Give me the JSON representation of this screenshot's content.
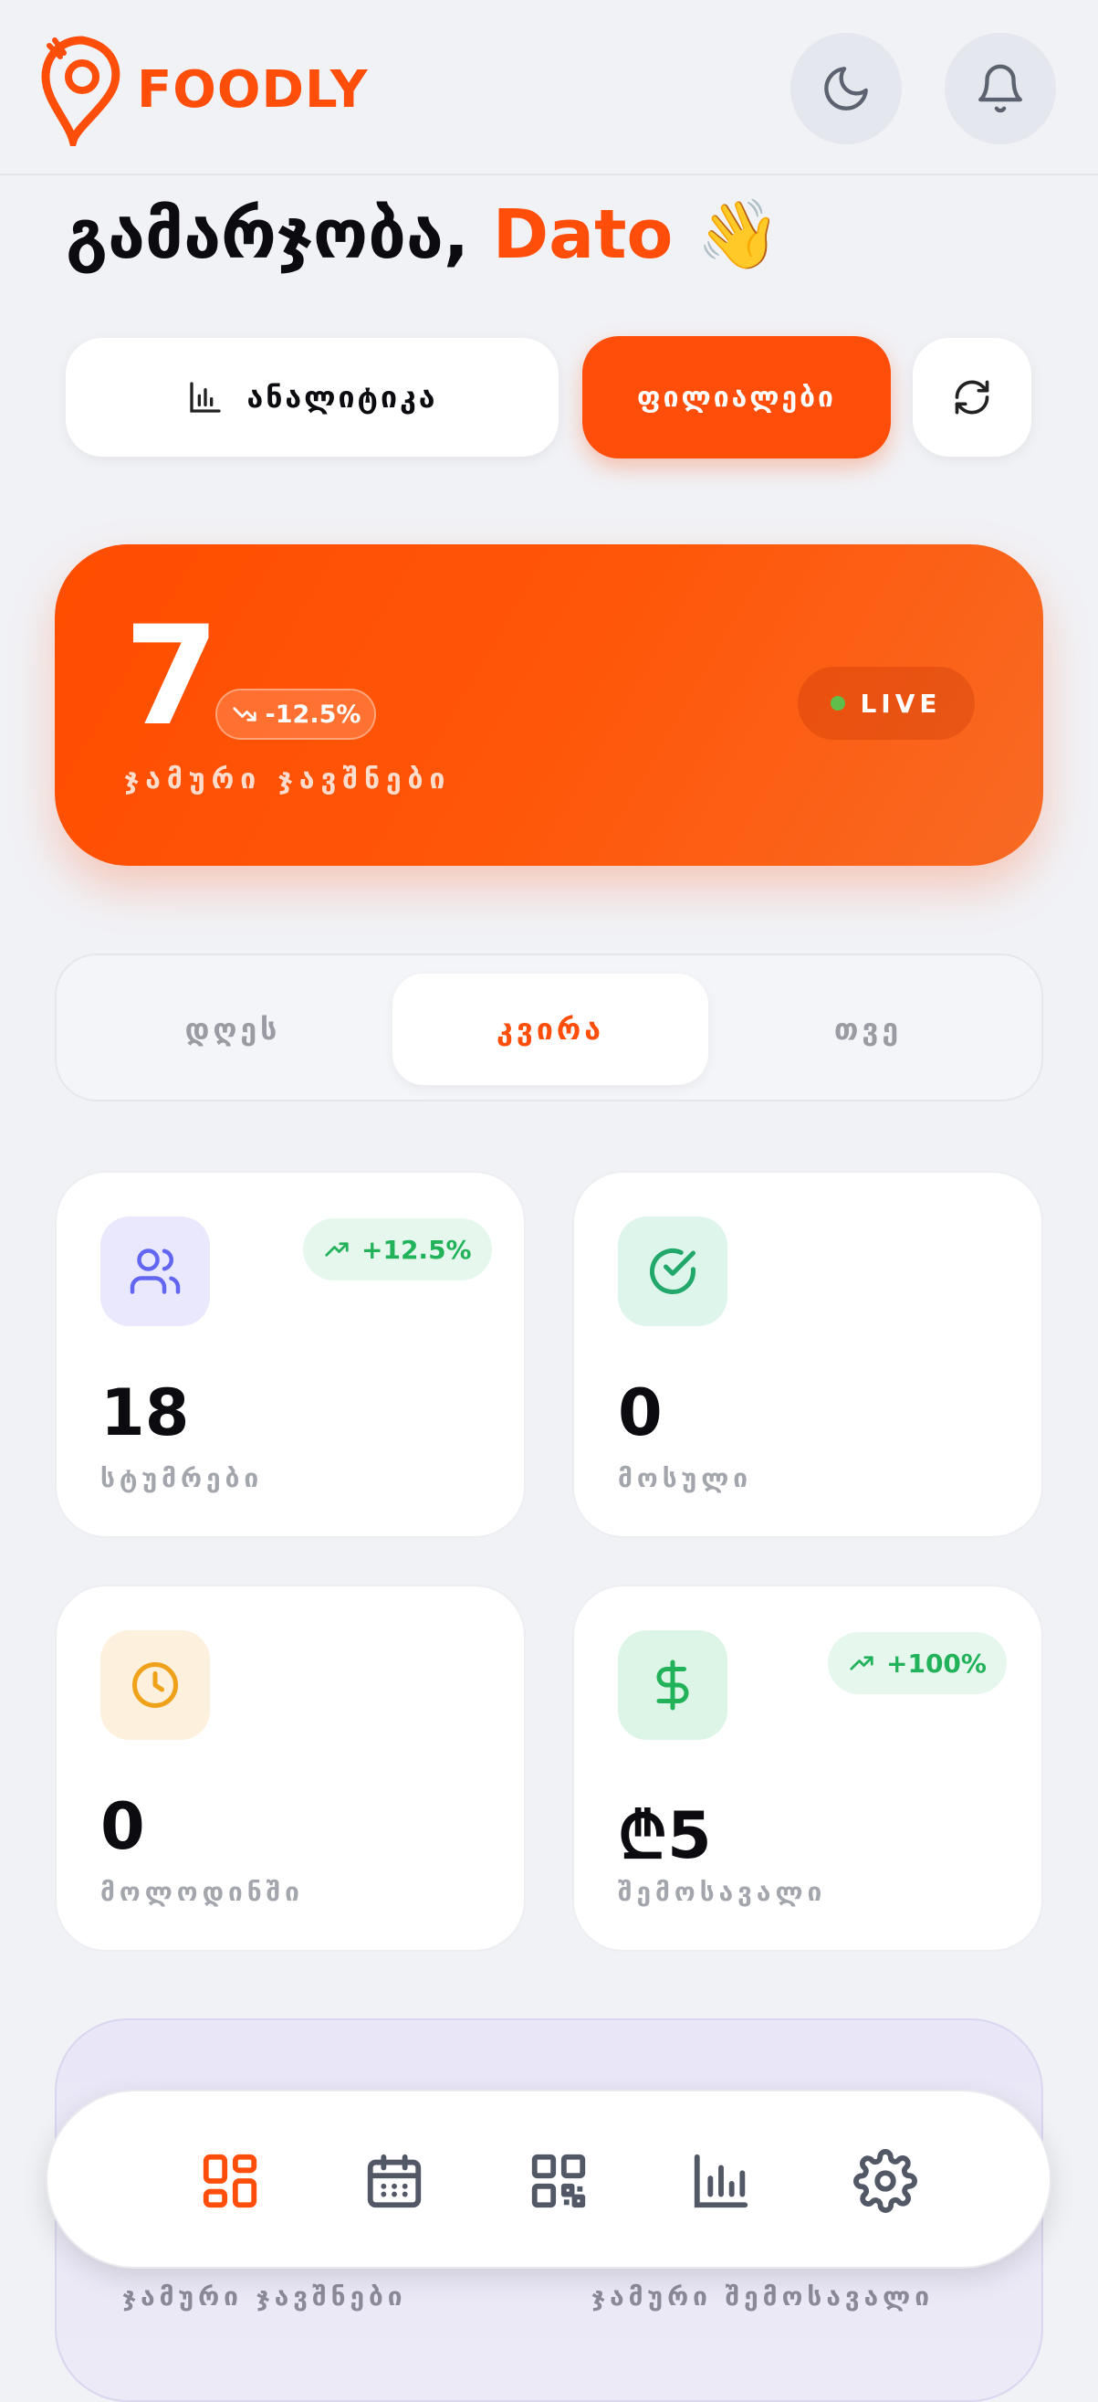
{
  "header": {
    "brand": "FOODLY",
    "colors": {
      "accent": "#ff4d0a"
    },
    "theme_icon": "moon-icon",
    "notification_icon": "bell-icon"
  },
  "greeting": {
    "text": "გამარჯობა,",
    "name": "Dato",
    "emoji": "👋"
  },
  "actions": {
    "analytics_label": "ანალიტიკა",
    "branches_label": "ფილიალები",
    "refresh_icon": "refresh-icon"
  },
  "hero": {
    "value": "7",
    "change": "-12.5%",
    "label": "ჯამური ჯავშნები",
    "live": "LIVE"
  },
  "periods": {
    "tabs": [
      "დღეს",
      "კვირა",
      "თვე"
    ],
    "active": "კვირა"
  },
  "stats": [
    {
      "value": "18",
      "label": "სტუმრები",
      "trend": "+12.5%",
      "icon": "users-icon"
    },
    {
      "value": "0",
      "label": "მოსული",
      "trend": "",
      "icon": "check-circle-icon"
    },
    {
      "value": "0",
      "label": "მოლოდინში",
      "trend": "",
      "icon": "clock-icon"
    },
    {
      "value": "₾5",
      "label": "შემოსავალი",
      "trend": "+100%",
      "icon": "dollar-icon"
    }
  ],
  "summary": {
    "left_label": "ჯამური ჯავშნები",
    "right_label": "ჯამური შემოსავალი"
  },
  "nav": {
    "items": [
      "dashboard-icon",
      "calendar-icon",
      "qr-icon",
      "chart-icon",
      "settings-icon"
    ],
    "active": "dashboard-icon"
  }
}
